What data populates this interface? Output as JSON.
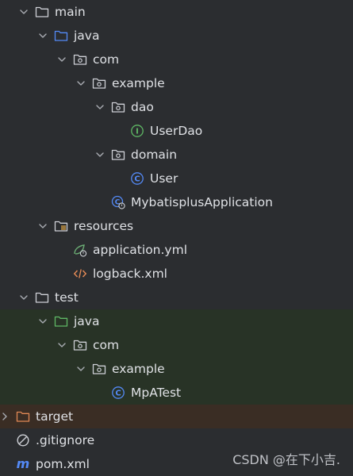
{
  "tree": [
    {
      "label": "main",
      "icon": "folder",
      "chevron": "down",
      "depth": 1,
      "bg": "none"
    },
    {
      "label": "java",
      "icon": "folder-source",
      "chevron": "down",
      "depth": 2,
      "bg": "none"
    },
    {
      "label": "com",
      "icon": "package",
      "chevron": "down",
      "depth": 3,
      "bg": "none"
    },
    {
      "label": "example",
      "icon": "package",
      "chevron": "down",
      "depth": 4,
      "bg": "none"
    },
    {
      "label": "dao",
      "icon": "package",
      "chevron": "down",
      "depth": 5,
      "bg": "none"
    },
    {
      "label": "UserDao",
      "icon": "interface",
      "chevron": "none",
      "depth": 6,
      "bg": "none"
    },
    {
      "label": "domain",
      "icon": "package",
      "chevron": "down",
      "depth": 5,
      "bg": "none"
    },
    {
      "label": "User",
      "icon": "class",
      "chevron": "none",
      "depth": 6,
      "bg": "none"
    },
    {
      "label": "MybatisplusApplication",
      "icon": "class-spring",
      "chevron": "none",
      "depth": 5,
      "bg": "none"
    },
    {
      "label": "resources",
      "icon": "folder-resources",
      "chevron": "down",
      "depth": 2,
      "bg": "none"
    },
    {
      "label": "application.yml",
      "icon": "spring-config",
      "chevron": "none",
      "depth": 3,
      "bg": "none"
    },
    {
      "label": "logback.xml",
      "icon": "xml",
      "chevron": "none",
      "depth": 3,
      "bg": "none"
    },
    {
      "label": "test",
      "icon": "folder",
      "chevron": "down",
      "depth": 1,
      "bg": "none"
    },
    {
      "label": "java",
      "icon": "folder-test",
      "chevron": "down",
      "depth": 2,
      "bg": "test"
    },
    {
      "label": "com",
      "icon": "package",
      "chevron": "down",
      "depth": 3,
      "bg": "test"
    },
    {
      "label": "example",
      "icon": "package",
      "chevron": "down",
      "depth": 4,
      "bg": "test"
    },
    {
      "label": "MpATest",
      "icon": "class",
      "chevron": "none",
      "depth": 5,
      "bg": "test"
    },
    {
      "label": "target",
      "icon": "folder-excluded",
      "chevron": "right",
      "depth": 0,
      "bg": "excluded"
    },
    {
      "label": ".gitignore",
      "icon": "ignored",
      "chevron": "none",
      "depth": 0,
      "bg": "none"
    },
    {
      "label": "pom.xml",
      "icon": "maven",
      "chevron": "none",
      "depth": 0,
      "bg": "none"
    }
  ],
  "watermark": "CSDN @在下小吉.",
  "colors": {
    "background": "#2b2d30",
    "text": "#dfe1e5",
    "chevron": "#a9acb2",
    "folder": "#ced0d6",
    "source_folder": "#548af7",
    "test_folder": "#5fb865",
    "excluded_folder": "#e08855",
    "class_icon": "#548af7",
    "interface_icon": "#5fb865",
    "spring_icon": "#6aab73",
    "xml_icon": "#e08855",
    "test_row_bg": "#283326",
    "excluded_row_bg": "#3a2d24"
  }
}
